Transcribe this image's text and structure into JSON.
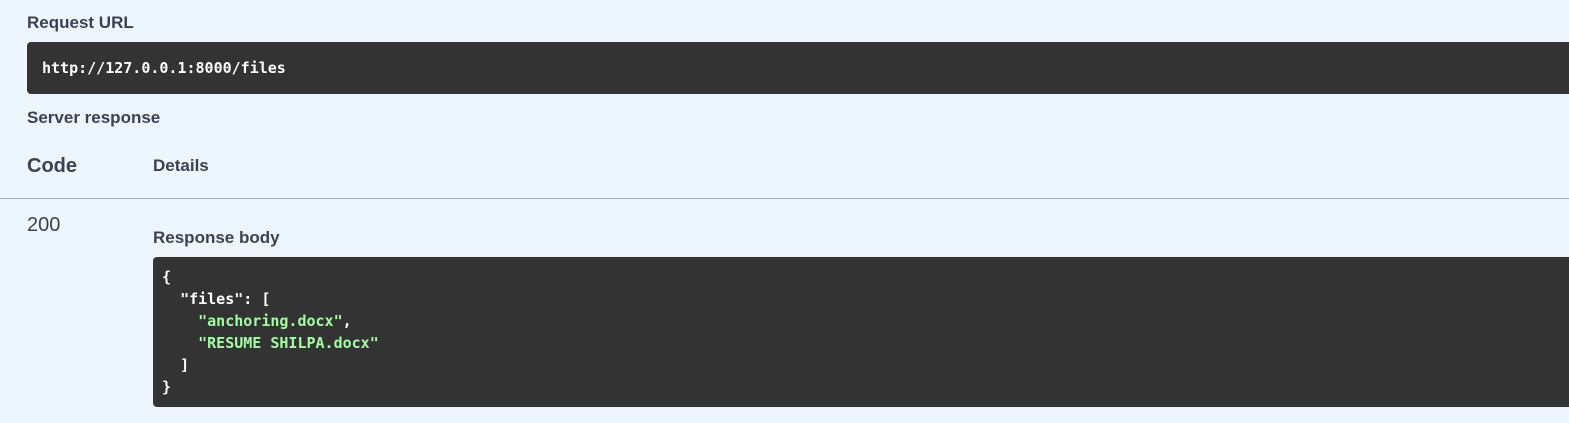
{
  "request_url": {
    "label": "Request URL",
    "value": "http://127.0.0.1:8000/files"
  },
  "server_response": {
    "label": "Server response",
    "columns": {
      "code": "Code",
      "details": "Details"
    },
    "row": {
      "status_code": "200",
      "response_body_label": "Response body",
      "body_lines": {
        "open_brace": "{",
        "files_key": "\"files\"",
        "files_sep": ": [",
        "item_0": "\"anchoring.docx\"",
        "item_0_sep": ",",
        "item_1": "\"RESUME SHILPA.docx\"",
        "close_bracket": "]",
        "close_brace": "}"
      }
    }
  },
  "colors": {
    "page_bg": "#eef6fd",
    "code_bg": "#333333",
    "string_color": "#a2fca2",
    "text_color": "#3b4151"
  }
}
